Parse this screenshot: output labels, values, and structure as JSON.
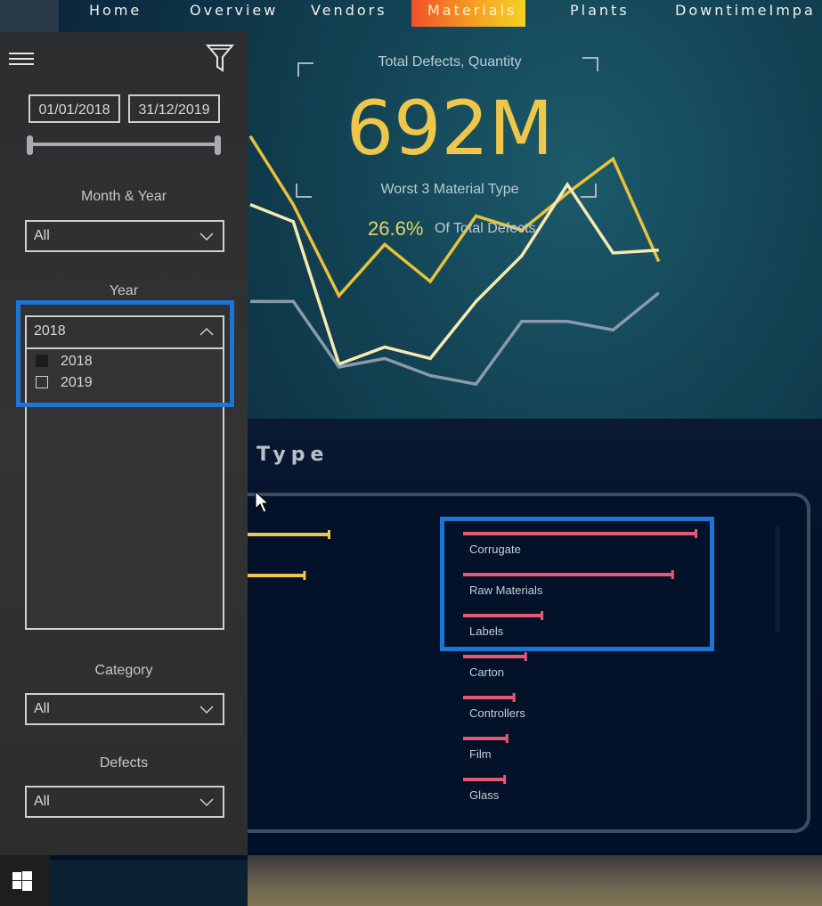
{
  "nav": {
    "tabs": [
      {
        "label": "Home",
        "active": false
      },
      {
        "label": "Overview",
        "active": false
      },
      {
        "label": "Vendors",
        "active": false
      },
      {
        "label": "Materials",
        "active": true
      },
      {
        "label": "Plants",
        "active": false
      },
      {
        "label": "DowntimeImpa",
        "active": false
      }
    ]
  },
  "sidebar": {
    "menu_icon": "hamburger-icon",
    "filter_icon": "funnel-icon",
    "date_range": {
      "start": "01/01/2018",
      "end": "31/12/2019"
    },
    "slicers": {
      "month_year": {
        "label": "Month & Year",
        "value": "All"
      },
      "year": {
        "label": "Year",
        "value": "2018",
        "expanded": true,
        "options": [
          {
            "label": "2018",
            "selected": true
          },
          {
            "label": "2019",
            "selected": false
          }
        ]
      },
      "category": {
        "label": "Category",
        "value": "All"
      },
      "defects": {
        "label": "Defects",
        "value": "All"
      }
    }
  },
  "kpi": {
    "title": "Total Defects, Quantity",
    "value": "692M",
    "subtitle": "Worst 3 Material Type",
    "percent": "26.6%",
    "percent_label": "Of Total Defects"
  },
  "colors": {
    "accent_yellow": "#eec64a",
    "line_cream": "#f7eab0",
    "line_gray": "#8a9aaa",
    "bar_pink": "#e35a72",
    "highlight_blue": "#1b74d6"
  },
  "section": {
    "title": "Type"
  },
  "chart_data": [
    {
      "type": "line",
      "title": "",
      "x": [
        1,
        2,
        3,
        4,
        5,
        6,
        7,
        8,
        9,
        10,
        11
      ],
      "series": [
        {
          "name": "series-yellow",
          "color": "#e8c23c",
          "values": [
            96,
            72,
            40,
            58,
            45,
            68,
            63,
            76,
            88,
            52,
            null
          ]
        },
        {
          "name": "series-cream",
          "color": "#f7eab0",
          "values": [
            72,
            66,
            16,
            22,
            18,
            38,
            54,
            79,
            55,
            56,
            null
          ]
        },
        {
          "name": "series-gray",
          "color": "#8a9aaa",
          "values": [
            38,
            38,
            15,
            18,
            12,
            9,
            31,
            31,
            28,
            41,
            null
          ]
        }
      ],
      "ylim": [
        0,
        100
      ]
    },
    {
      "type": "bar",
      "orientation": "horizontal",
      "categories": [
        "Corrugate",
        "Raw Materials",
        "Labels",
        "Carton",
        "Controllers",
        "Film",
        "Glass"
      ],
      "values": [
        100,
        90,
        34,
        27,
        22,
        19,
        18
      ],
      "xlim": [
        0,
        100
      ]
    },
    {
      "type": "bar",
      "orientation": "horizontal",
      "categories": [
        "",
        ""
      ],
      "values": [
        100,
        70
      ],
      "xlim": [
        0,
        100
      ]
    }
  ]
}
